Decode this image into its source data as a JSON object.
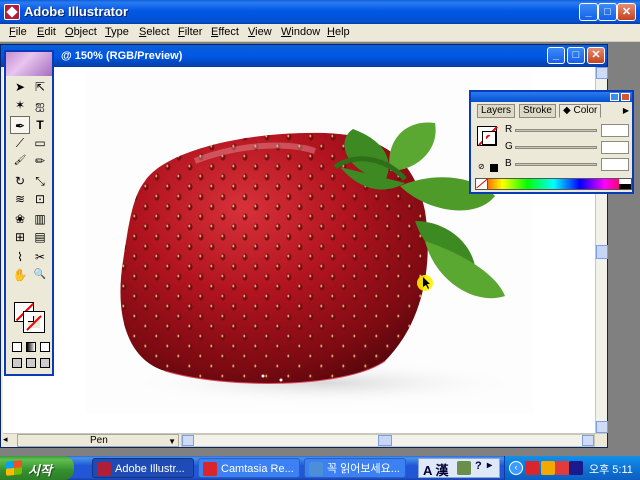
{
  "window": {
    "title": "Adobe Illustrator",
    "minimize": "_",
    "maximize": "□",
    "close": "✕"
  },
  "menu": [
    "File",
    "Edit",
    "Object",
    "Type",
    "Select",
    "Filter",
    "Effect",
    "View",
    "Window",
    "Help"
  ],
  "document": {
    "title": "@ 150% (RGB/Preview)",
    "status_tool": "Pen",
    "zoom_arrow": "◂"
  },
  "toolbox": {
    "tools": [
      {
        "name": "selection-tool-icon",
        "glyph": "➤"
      },
      {
        "name": "direct-selection-tool-icon",
        "glyph": "⇱"
      },
      {
        "name": "magic-wand-tool-icon",
        "glyph": "✶"
      },
      {
        "name": "lasso-tool-icon",
        "glyph": "ஐ"
      },
      {
        "name": "pen-tool-icon",
        "glyph": "✒"
      },
      {
        "name": "type-tool-icon",
        "glyph": "T"
      },
      {
        "name": "line-tool-icon",
        "glyph": "⟋"
      },
      {
        "name": "rectangle-tool-icon",
        "glyph": "▭"
      },
      {
        "name": "paintbrush-tool-icon",
        "glyph": "🖌"
      },
      {
        "name": "pencil-tool-icon",
        "glyph": "✏"
      },
      {
        "name": "rotate-tool-icon",
        "glyph": "↻"
      },
      {
        "name": "scale-tool-icon",
        "glyph": "⤡"
      },
      {
        "name": "warp-tool-icon",
        "glyph": "≋"
      },
      {
        "name": "free-transform-tool-icon",
        "glyph": "⊡"
      },
      {
        "name": "symbol-sprayer-tool-icon",
        "glyph": "❀"
      },
      {
        "name": "graph-tool-icon",
        "glyph": "▥"
      },
      {
        "name": "mesh-tool-icon",
        "glyph": "⊞"
      },
      {
        "name": "gradient-tool-icon",
        "glyph": "▤"
      },
      {
        "name": "eyedropper-tool-icon",
        "glyph": "⌇"
      },
      {
        "name": "blend-tool-icon",
        "glyph": "⚯"
      },
      {
        "name": "slice-tool-icon",
        "glyph": "⌥"
      },
      {
        "name": "scissors-tool-icon",
        "glyph": "✂"
      },
      {
        "name": "hand-tool-icon",
        "glyph": "✋"
      },
      {
        "name": "zoom-tool-icon",
        "glyph": "🔍"
      }
    ]
  },
  "color_panel": {
    "tabs": [
      "Layers",
      "Stroke",
      "Color"
    ],
    "active_tab": "Color",
    "channels": [
      {
        "label": "R",
        "value": ""
      },
      {
        "label": "G",
        "value": ""
      },
      {
        "label": "B",
        "value": ""
      }
    ]
  },
  "taskbar": {
    "start_label": "시작",
    "tasks": [
      {
        "label": "Adobe Illustr...",
        "active": true,
        "icon_color": "#b01f3a"
      },
      {
        "label": "Camtasia Re...",
        "active": false,
        "icon_color": "#d8262a"
      },
      {
        "label": "꼭 읽어보세요...",
        "active": false,
        "icon_color": "#4c8fd6"
      }
    ],
    "ime_text": "A 漢",
    "clock": "오후 5:11"
  },
  "colors": {
    "xp_blue": "#0058e6",
    "strawberry_red": "#b2141f",
    "leaf_green": "#4f9b2a",
    "cursor_highlight": "#ffee00"
  }
}
